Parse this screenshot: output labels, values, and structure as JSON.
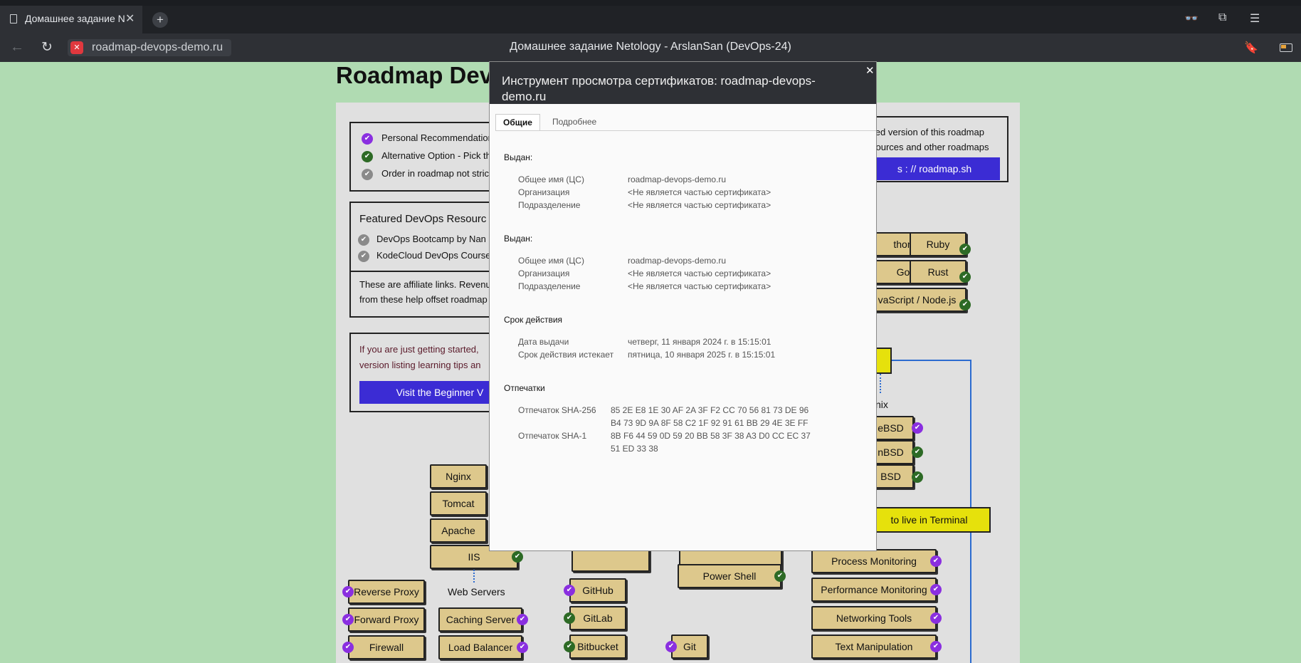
{
  "browser": {
    "tab_title": "Домашнее задание Net",
    "tab_close": "✕",
    "new_tab": "+",
    "url": "roadmap-devops-demo.ru",
    "page_title": "Домашнее задание Netology - ArslanSan (DevOps-24)"
  },
  "page": {
    "heading": "Roadmap Dev",
    "legend": [
      {
        "text": "Personal Recommendation",
        "status": "purple"
      },
      {
        "text": "Alternative Option - Pick this",
        "status": "green"
      },
      {
        "text": "Order in roadmap not strict",
        "status": "gray"
      }
    ],
    "featured": {
      "title": "Featured DevOps Resourc",
      "items": [
        "DevOps Bootcamp by Nan",
        "KodeCloud DevOps Course"
      ],
      "note_line1": "These are affiliate links. Revenu",
      "note_line2": "from these help offset roadmap"
    },
    "beginner": {
      "line1": "If you are just getting started,",
      "line2": "version listing learning tips an",
      "button": "Visit the Beginner V"
    },
    "promo": {
      "line1": "iled version of this roadmap",
      "line2": "sources and other roadmaps",
      "button": "s : // roadmap.sh"
    },
    "nodes": {
      "python": "thon",
      "ruby": "Ruby",
      "go": "Go",
      "rust": "Rust",
      "js": "vaScript / Node.js",
      "nginx": "Nginx",
      "tomcat": "Tomcat",
      "apache": "Apache",
      "iis": "IIS",
      "web_servers": "Web Servers",
      "reverse_proxy": "Reverse Proxy",
      "forward_proxy": "Forward Proxy",
      "firewall": "Firewall",
      "caching_server": "Caching Server",
      "load_balancer": "Load Balancer",
      "github": "GitHub",
      "gitlab": "GitLab",
      "bitbucket": "Bitbucket",
      "git": "Git",
      "power_shell": "Power Shell",
      "unix": "nix",
      "freebsd": "eBSD",
      "openbsd": "nBSD",
      "netbsd": "BSD",
      "terminal": "to live in Terminal",
      "process_monitoring": "Process Monitoring",
      "performance_monitoring": "Performance Monitoring",
      "networking_tools": "Networking Tools",
      "text_manipulation": "Text Manipulation"
    }
  },
  "cert_dialog": {
    "title": "Инструмент просмотра сертификатов: roadmap-devops-demo.ru",
    "close": "✕",
    "tabs": {
      "general": "Общие",
      "details": "Подробнее"
    },
    "issued_to": {
      "heading": "Выдан:",
      "rows": [
        {
          "label": "Общее имя (ЦС)",
          "value": "roadmap-devops-demo.ru"
        },
        {
          "label": "Организация",
          "value": "<Не является частью сертификата>"
        },
        {
          "label": "Подразделение",
          "value": "<Не является частью сертификата>"
        }
      ]
    },
    "issued_by": {
      "heading": "Выдан:",
      "rows": [
        {
          "label": "Общее имя (ЦС)",
          "value": "roadmap-devops-demo.ru"
        },
        {
          "label": "Организация",
          "value": "<Не является частью сертификата>"
        },
        {
          "label": "Подразделение",
          "value": "<Не является частью сертификата>"
        }
      ]
    },
    "validity": {
      "heading": "Срок действия",
      "rows": [
        {
          "label": "Дата выдачи",
          "value": "четверг, 11 января 2024 г. в 15:15:01"
        },
        {
          "label": "Срок действия истекает",
          "value": "пятница, 10 января 2025 г. в 15:15:01"
        }
      ]
    },
    "fingerprints": {
      "heading": "Отпечатки",
      "sha256_label": "Отпечаток SHA-256",
      "sha256_line1": "85 2E E8 1E 30 AF 2A 3F F2 CC 70 56 81 73 DE 96",
      "sha256_line2": "B4 73 9D 9A 8F 58 C2 1F 92 91 61 BB 29 4E 3E FF",
      "sha1_label": "Отпечаток SHA-1",
      "sha1_line1": "8B F6 44 59 0D 59 20 BB 58 3F 38 A3 D0 CC EC 37",
      "sha1_line2": "51 ED 33 38"
    }
  }
}
